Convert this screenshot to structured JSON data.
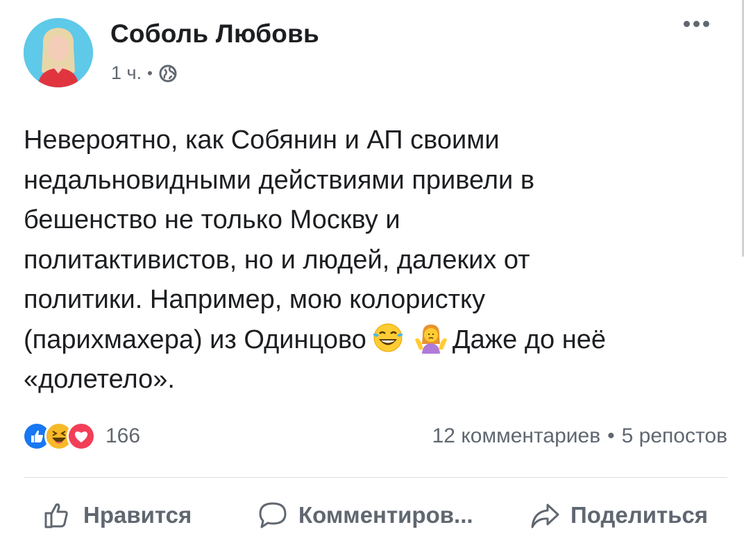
{
  "post": {
    "author": "Соболь Любовь",
    "time": "1 ч.",
    "separator": "•",
    "privacy_icon": "globe-icon",
    "menu_icon": "more-dots-icon",
    "text_lines": [
      "Невероятно, как Собянин и АП своими",
      "недальновидными действиями привели в",
      "бешенство не только Москву и",
      "политактивистов, но и людей, далеких от",
      "политики. Например, мою колористку"
    ],
    "line6_before": "(парихмахера) из Одинцово",
    "line6_emojis": [
      "tears-of-joy-emoji",
      "shrugging-woman-emoji"
    ],
    "line6_after": "Даже до неё",
    "line7": "«долетело»."
  },
  "reactions": {
    "icons": [
      "like-reaction-icon",
      "haha-reaction-icon",
      "love-reaction-icon"
    ],
    "count": "166",
    "comments": "12 комментариев",
    "dot": "•",
    "shares": "5 репостов"
  },
  "actions": {
    "like": "Нравится",
    "comment": "Комментиров...",
    "share": "Поделиться"
  },
  "colors": {
    "like_blue": "#1877f2",
    "love_red": "#f33e58",
    "haha_yellow": "#f7b928",
    "text": "#1c1e21",
    "secondary": "#606770"
  }
}
